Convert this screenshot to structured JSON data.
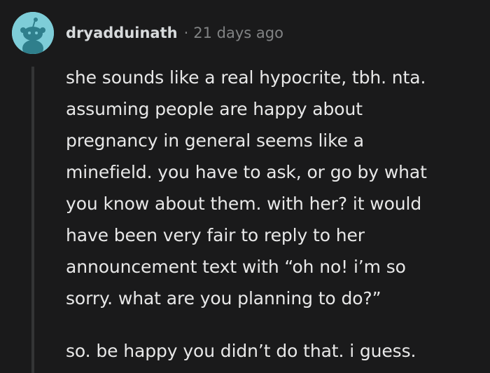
{
  "comment": {
    "username": "dryadduinath",
    "separator": "·",
    "timestamp": "21 days ago",
    "avatar_icon": "snoo-avatar-icon",
    "body_lines": [
      "she sounds like a real hypocrite, tbh. nta.",
      "assuming people are happy about",
      "pregnancy in general seems like a",
      "minefield. you have to ask, or go by what",
      "you know about them. with her? it would",
      "have been very fair to reply to her",
      "announcement text with “oh no! i’m so",
      "sorry. what are you planning to do?”"
    ],
    "body_paragraph_2": "so. be happy you didn’t do that. i guess."
  },
  "colors": {
    "background": "#1a1a1b",
    "avatar_bg": "#7ecdd8",
    "text": "#d7dadc",
    "meta": "#818384",
    "thread_line": "#343536"
  }
}
